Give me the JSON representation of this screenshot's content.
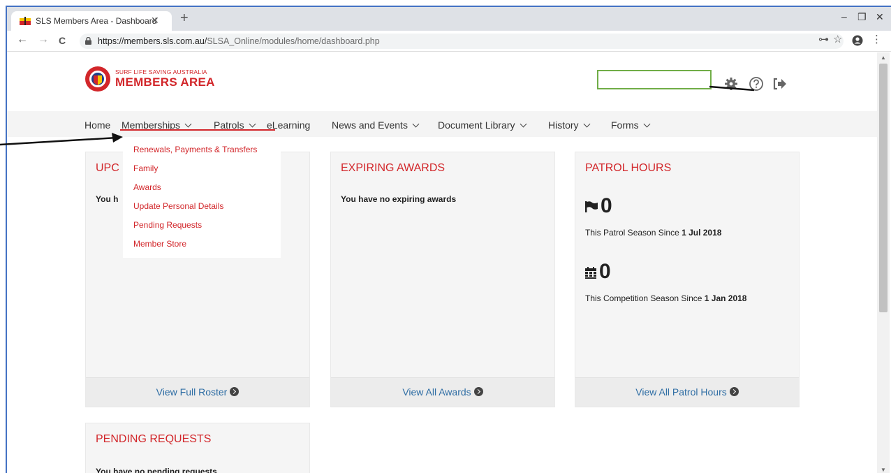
{
  "browser": {
    "tab_title": "SLS Members Area - Dashboard",
    "tab_close": "✕",
    "new_tab": "+",
    "url_host": "https://members.sls.com.au/",
    "url_path": "SLSA_Online/modules/home/dashboard.php",
    "window_controls": {
      "minimize": "–",
      "restore": "❐",
      "close": "✕"
    },
    "nav": {
      "back": "←",
      "forward": "→",
      "reload": "C"
    },
    "url_icons": {
      "key": "⊶",
      "star": "☆",
      "account": "●",
      "menu": "⋮"
    }
  },
  "header": {
    "logo_small": "SURF LIFE SAVING AUSTRALIA",
    "logo_big": "MEMBERS AREA",
    "icons": [
      "gear-icon",
      "help-icon",
      "sign-out-icon"
    ]
  },
  "menu": {
    "items": [
      {
        "label": "Home",
        "dropdown": false
      },
      {
        "label": "Memberships",
        "dropdown": true
      },
      {
        "label": "Patrols",
        "dropdown": true
      },
      {
        "label": "eLearning",
        "dropdown": false
      },
      {
        "label": "News and Events",
        "dropdown": true
      },
      {
        "label": "Document Library",
        "dropdown": true
      },
      {
        "label": "History",
        "dropdown": true
      },
      {
        "label": "Forms",
        "dropdown": true
      }
    ]
  },
  "dropdown": {
    "items": [
      "Renewals, Payments & Transfers",
      "Family",
      "Awards",
      "Update Personal Details",
      "Pending Requests",
      "Member Store"
    ]
  },
  "cards": {
    "upcoming": {
      "title": "UPC",
      "message": "You h",
      "footer": "View Full Roster"
    },
    "expiring": {
      "title": "EXPIRING AWARDS",
      "message": "You have no expiring awards",
      "footer": "View All Awards"
    },
    "patrol": {
      "title": "PATROL HOURS",
      "patrol_count": "0",
      "patrol_since_label": "This Patrol Season Since ",
      "patrol_since_date": "1 Jul 2018",
      "comp_count": "0",
      "comp_since_label": "This Competition Season Since ",
      "comp_since_date": "1 Jan 2018",
      "footer": "View All Patrol Hours"
    },
    "pending": {
      "title": "PENDING REQUESTS",
      "message": "You have no pending requests"
    }
  },
  "colors": {
    "brand_red": "#d2262a",
    "link_blue": "#2e6da4",
    "highlight_green": "#70ad47",
    "frame_blue": "#4472c4"
  }
}
